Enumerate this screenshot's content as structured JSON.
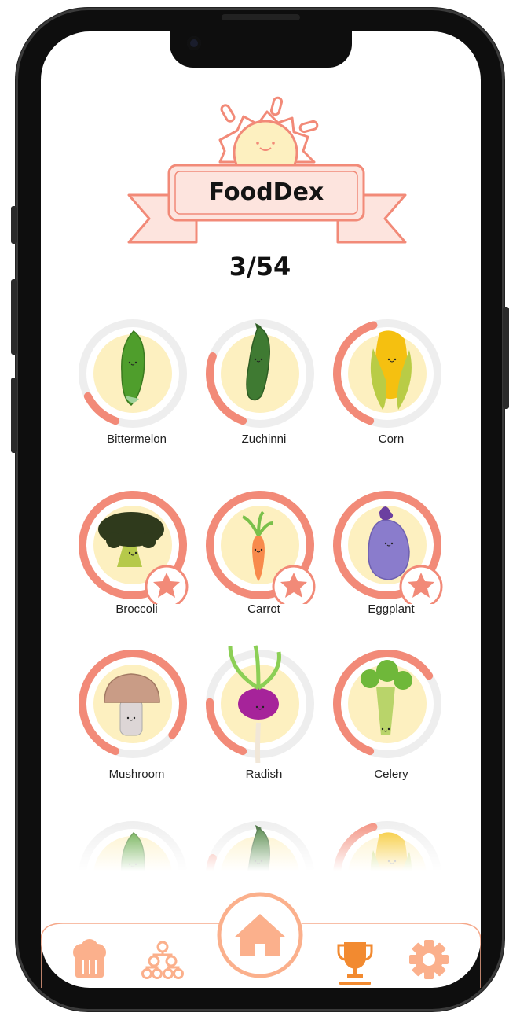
{
  "app": {
    "title": "FoodDex",
    "progress_text": "3/54"
  },
  "colors": {
    "accent": "#f28a78",
    "ring_track": "#eeeeee",
    "disc": "#fdf0c0",
    "ribbon_fill": "#fde4de",
    "nav_orange": "#fbb08c",
    "nav_active": "#f28a30"
  },
  "foods": [
    {
      "name": "Bittermelon",
      "progress": 0.12,
      "starred": false,
      "icon": "bittermelon-icon"
    },
    {
      "name": "Zuchinni",
      "progress": 0.25,
      "starred": false,
      "icon": "zucchini-icon"
    },
    {
      "name": "Corn",
      "progress": 0.4,
      "starred": false,
      "icon": "corn-icon"
    },
    {
      "name": "Broccoli",
      "progress": 1,
      "starred": true,
      "icon": "broccoli-icon"
    },
    {
      "name": "Carrot",
      "progress": 1,
      "starred": true,
      "icon": "carrot-icon"
    },
    {
      "name": "Eggplant",
      "progress": 1,
      "starred": true,
      "icon": "eggplant-icon"
    },
    {
      "name": "Mushroom",
      "progress": 0.8,
      "starred": false,
      "icon": "mushroom-icon"
    },
    {
      "name": "Radish",
      "progress": 0.2,
      "starred": false,
      "icon": "radish-icon"
    },
    {
      "name": "Celery",
      "progress": 0.6,
      "starred": false,
      "icon": "celery-icon"
    }
  ],
  "nav": {
    "items": [
      {
        "icon": "chef-hat-icon",
        "active": false
      },
      {
        "icon": "skill-tree-icon",
        "active": false
      },
      {
        "icon": "home-icon",
        "active": false
      },
      {
        "icon": "trophy-icon",
        "active": true
      },
      {
        "icon": "settings-gear-icon",
        "active": false
      }
    ]
  }
}
